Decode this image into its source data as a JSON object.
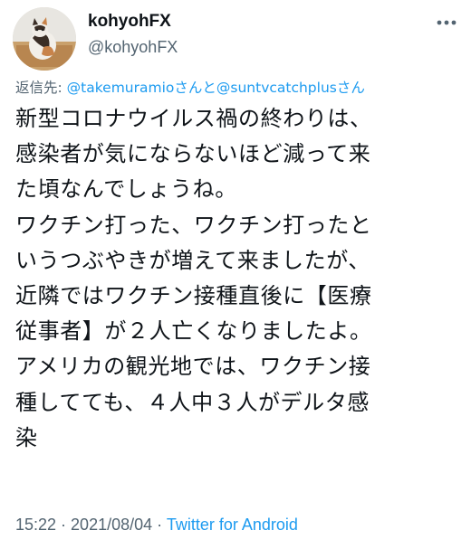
{
  "author": {
    "display_name": "kohyohFX",
    "handle": "@kohyohFX",
    "avatar_icon": "cat-photo-avatar"
  },
  "more_icon": "ellipsis-icon",
  "reply": {
    "prefix": "返信先: ",
    "mention_1": "@takemuramio",
    "joiner_1": "さんと",
    "mention_2": "@suntvcatchplus",
    "joiner_2": "さん"
  },
  "tweet_lines": [
    "新型コロナウイルス禍の終わりは、",
    "感染者が気にならないほど減って来",
    "た頃なんでしょうね。",
    "ワクチン打った、ワクチン打ったと",
    "いうつぶやきが増えて来ましたが、",
    "近隣ではワクチン接種直後に【医療",
    "従事者】が２人亡くなりましたよ。",
    "アメリカの観光地では、ワクチン接",
    "種してても、４人中３人がデルタ感",
    "染"
  ],
  "meta": {
    "time": "15:22",
    "separator_1": " · ",
    "date": "2021/08/04",
    "separator_2": " · ",
    "source": "Twitter for Android"
  },
  "colors": {
    "link": "#1d9bf0",
    "secondary": "#536471",
    "text": "#0f1419"
  }
}
